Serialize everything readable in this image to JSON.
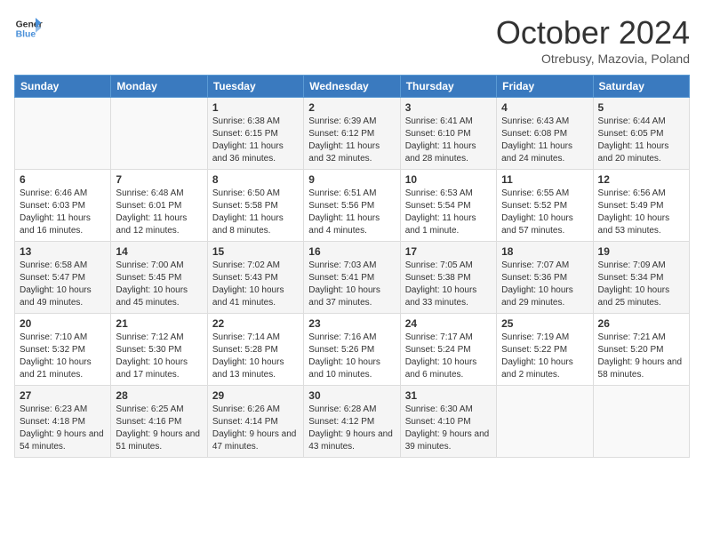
{
  "header": {
    "logo_general": "General",
    "logo_blue": "Blue",
    "month_title": "October 2024",
    "location": "Otrebusy, Mazovia, Poland"
  },
  "days_of_week": [
    "Sunday",
    "Monday",
    "Tuesday",
    "Wednesday",
    "Thursday",
    "Friday",
    "Saturday"
  ],
  "weeks": [
    [
      {
        "day": "",
        "info": ""
      },
      {
        "day": "",
        "info": ""
      },
      {
        "day": "1",
        "info": "Sunrise: 6:38 AM\nSunset: 6:15 PM\nDaylight: 11 hours\nand 36 minutes."
      },
      {
        "day": "2",
        "info": "Sunrise: 6:39 AM\nSunset: 6:12 PM\nDaylight: 11 hours\nand 32 minutes."
      },
      {
        "day": "3",
        "info": "Sunrise: 6:41 AM\nSunset: 6:10 PM\nDaylight: 11 hours\nand 28 minutes."
      },
      {
        "day": "4",
        "info": "Sunrise: 6:43 AM\nSunset: 6:08 PM\nDaylight: 11 hours\nand 24 minutes."
      },
      {
        "day": "5",
        "info": "Sunrise: 6:44 AM\nSunset: 6:05 PM\nDaylight: 11 hours\nand 20 minutes."
      }
    ],
    [
      {
        "day": "6",
        "info": "Sunrise: 6:46 AM\nSunset: 6:03 PM\nDaylight: 11 hours\nand 16 minutes."
      },
      {
        "day": "7",
        "info": "Sunrise: 6:48 AM\nSunset: 6:01 PM\nDaylight: 11 hours\nand 12 minutes."
      },
      {
        "day": "8",
        "info": "Sunrise: 6:50 AM\nSunset: 5:58 PM\nDaylight: 11 hours\nand 8 minutes."
      },
      {
        "day": "9",
        "info": "Sunrise: 6:51 AM\nSunset: 5:56 PM\nDaylight: 11 hours\nand 4 minutes."
      },
      {
        "day": "10",
        "info": "Sunrise: 6:53 AM\nSunset: 5:54 PM\nDaylight: 11 hours\nand 1 minute."
      },
      {
        "day": "11",
        "info": "Sunrise: 6:55 AM\nSunset: 5:52 PM\nDaylight: 10 hours\nand 57 minutes."
      },
      {
        "day": "12",
        "info": "Sunrise: 6:56 AM\nSunset: 5:49 PM\nDaylight: 10 hours\nand 53 minutes."
      }
    ],
    [
      {
        "day": "13",
        "info": "Sunrise: 6:58 AM\nSunset: 5:47 PM\nDaylight: 10 hours\nand 49 minutes."
      },
      {
        "day": "14",
        "info": "Sunrise: 7:00 AM\nSunset: 5:45 PM\nDaylight: 10 hours\nand 45 minutes."
      },
      {
        "day": "15",
        "info": "Sunrise: 7:02 AM\nSunset: 5:43 PM\nDaylight: 10 hours\nand 41 minutes."
      },
      {
        "day": "16",
        "info": "Sunrise: 7:03 AM\nSunset: 5:41 PM\nDaylight: 10 hours\nand 37 minutes."
      },
      {
        "day": "17",
        "info": "Sunrise: 7:05 AM\nSunset: 5:38 PM\nDaylight: 10 hours\nand 33 minutes."
      },
      {
        "day": "18",
        "info": "Sunrise: 7:07 AM\nSunset: 5:36 PM\nDaylight: 10 hours\nand 29 minutes."
      },
      {
        "day": "19",
        "info": "Sunrise: 7:09 AM\nSunset: 5:34 PM\nDaylight: 10 hours\nand 25 minutes."
      }
    ],
    [
      {
        "day": "20",
        "info": "Sunrise: 7:10 AM\nSunset: 5:32 PM\nDaylight: 10 hours\nand 21 minutes."
      },
      {
        "day": "21",
        "info": "Sunrise: 7:12 AM\nSunset: 5:30 PM\nDaylight: 10 hours\nand 17 minutes."
      },
      {
        "day": "22",
        "info": "Sunrise: 7:14 AM\nSunset: 5:28 PM\nDaylight: 10 hours\nand 13 minutes."
      },
      {
        "day": "23",
        "info": "Sunrise: 7:16 AM\nSunset: 5:26 PM\nDaylight: 10 hours\nand 10 minutes."
      },
      {
        "day": "24",
        "info": "Sunrise: 7:17 AM\nSunset: 5:24 PM\nDaylight: 10 hours\nand 6 minutes."
      },
      {
        "day": "25",
        "info": "Sunrise: 7:19 AM\nSunset: 5:22 PM\nDaylight: 10 hours\nand 2 minutes."
      },
      {
        "day": "26",
        "info": "Sunrise: 7:21 AM\nSunset: 5:20 PM\nDaylight: 9 hours\nand 58 minutes."
      }
    ],
    [
      {
        "day": "27",
        "info": "Sunrise: 6:23 AM\nSunset: 4:18 PM\nDaylight: 9 hours\nand 54 minutes."
      },
      {
        "day": "28",
        "info": "Sunrise: 6:25 AM\nSunset: 4:16 PM\nDaylight: 9 hours\nand 51 minutes."
      },
      {
        "day": "29",
        "info": "Sunrise: 6:26 AM\nSunset: 4:14 PM\nDaylight: 9 hours\nand 47 minutes."
      },
      {
        "day": "30",
        "info": "Sunrise: 6:28 AM\nSunset: 4:12 PM\nDaylight: 9 hours\nand 43 minutes."
      },
      {
        "day": "31",
        "info": "Sunrise: 6:30 AM\nSunset: 4:10 PM\nDaylight: 9 hours\nand 39 minutes."
      },
      {
        "day": "",
        "info": ""
      },
      {
        "day": "",
        "info": ""
      }
    ]
  ]
}
